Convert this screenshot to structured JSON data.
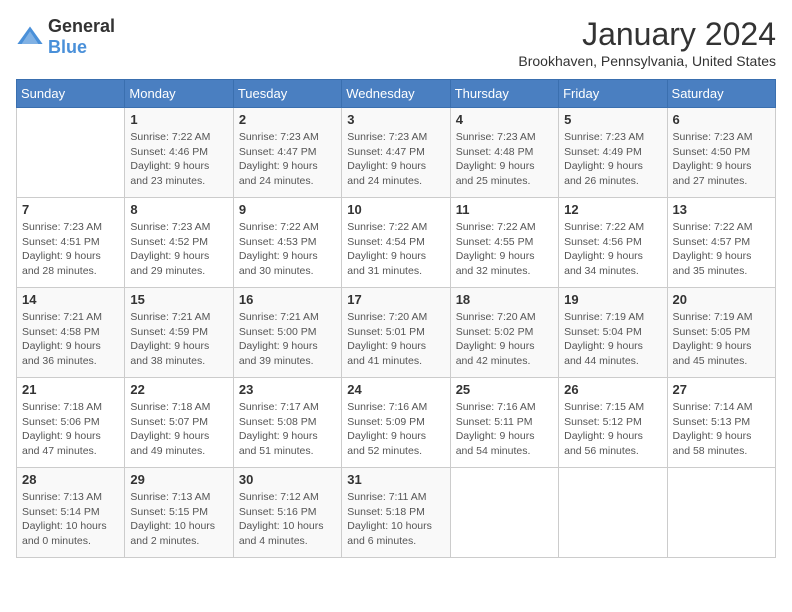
{
  "logo": {
    "general": "General",
    "blue": "Blue"
  },
  "title": "January 2024",
  "subtitle": "Brookhaven, Pennsylvania, United States",
  "header_days": [
    "Sunday",
    "Monday",
    "Tuesday",
    "Wednesday",
    "Thursday",
    "Friday",
    "Saturday"
  ],
  "weeks": [
    [
      {
        "day": "",
        "sunrise": "",
        "sunset": "",
        "daylight": ""
      },
      {
        "day": "1",
        "sunrise": "Sunrise: 7:22 AM",
        "sunset": "Sunset: 4:46 PM",
        "daylight": "Daylight: 9 hours and 23 minutes."
      },
      {
        "day": "2",
        "sunrise": "Sunrise: 7:23 AM",
        "sunset": "Sunset: 4:47 PM",
        "daylight": "Daylight: 9 hours and 24 minutes."
      },
      {
        "day": "3",
        "sunrise": "Sunrise: 7:23 AM",
        "sunset": "Sunset: 4:47 PM",
        "daylight": "Daylight: 9 hours and 24 minutes."
      },
      {
        "day": "4",
        "sunrise": "Sunrise: 7:23 AM",
        "sunset": "Sunset: 4:48 PM",
        "daylight": "Daylight: 9 hours and 25 minutes."
      },
      {
        "day": "5",
        "sunrise": "Sunrise: 7:23 AM",
        "sunset": "Sunset: 4:49 PM",
        "daylight": "Daylight: 9 hours and 26 minutes."
      },
      {
        "day": "6",
        "sunrise": "Sunrise: 7:23 AM",
        "sunset": "Sunset: 4:50 PM",
        "daylight": "Daylight: 9 hours and 27 minutes."
      }
    ],
    [
      {
        "day": "7",
        "sunrise": "Sunrise: 7:23 AM",
        "sunset": "Sunset: 4:51 PM",
        "daylight": "Daylight: 9 hours and 28 minutes."
      },
      {
        "day": "8",
        "sunrise": "Sunrise: 7:23 AM",
        "sunset": "Sunset: 4:52 PM",
        "daylight": "Daylight: 9 hours and 29 minutes."
      },
      {
        "day": "9",
        "sunrise": "Sunrise: 7:22 AM",
        "sunset": "Sunset: 4:53 PM",
        "daylight": "Daylight: 9 hours and 30 minutes."
      },
      {
        "day": "10",
        "sunrise": "Sunrise: 7:22 AM",
        "sunset": "Sunset: 4:54 PM",
        "daylight": "Daylight: 9 hours and 31 minutes."
      },
      {
        "day": "11",
        "sunrise": "Sunrise: 7:22 AM",
        "sunset": "Sunset: 4:55 PM",
        "daylight": "Daylight: 9 hours and 32 minutes."
      },
      {
        "day": "12",
        "sunrise": "Sunrise: 7:22 AM",
        "sunset": "Sunset: 4:56 PM",
        "daylight": "Daylight: 9 hours and 34 minutes."
      },
      {
        "day": "13",
        "sunrise": "Sunrise: 7:22 AM",
        "sunset": "Sunset: 4:57 PM",
        "daylight": "Daylight: 9 hours and 35 minutes."
      }
    ],
    [
      {
        "day": "14",
        "sunrise": "Sunrise: 7:21 AM",
        "sunset": "Sunset: 4:58 PM",
        "daylight": "Daylight: 9 hours and 36 minutes."
      },
      {
        "day": "15",
        "sunrise": "Sunrise: 7:21 AM",
        "sunset": "Sunset: 4:59 PM",
        "daylight": "Daylight: 9 hours and 38 minutes."
      },
      {
        "day": "16",
        "sunrise": "Sunrise: 7:21 AM",
        "sunset": "Sunset: 5:00 PM",
        "daylight": "Daylight: 9 hours and 39 minutes."
      },
      {
        "day": "17",
        "sunrise": "Sunrise: 7:20 AM",
        "sunset": "Sunset: 5:01 PM",
        "daylight": "Daylight: 9 hours and 41 minutes."
      },
      {
        "day": "18",
        "sunrise": "Sunrise: 7:20 AM",
        "sunset": "Sunset: 5:02 PM",
        "daylight": "Daylight: 9 hours and 42 minutes."
      },
      {
        "day": "19",
        "sunrise": "Sunrise: 7:19 AM",
        "sunset": "Sunset: 5:04 PM",
        "daylight": "Daylight: 9 hours and 44 minutes."
      },
      {
        "day": "20",
        "sunrise": "Sunrise: 7:19 AM",
        "sunset": "Sunset: 5:05 PM",
        "daylight": "Daylight: 9 hours and 45 minutes."
      }
    ],
    [
      {
        "day": "21",
        "sunrise": "Sunrise: 7:18 AM",
        "sunset": "Sunset: 5:06 PM",
        "daylight": "Daylight: 9 hours and 47 minutes."
      },
      {
        "day": "22",
        "sunrise": "Sunrise: 7:18 AM",
        "sunset": "Sunset: 5:07 PM",
        "daylight": "Daylight: 9 hours and 49 minutes."
      },
      {
        "day": "23",
        "sunrise": "Sunrise: 7:17 AM",
        "sunset": "Sunset: 5:08 PM",
        "daylight": "Daylight: 9 hours and 51 minutes."
      },
      {
        "day": "24",
        "sunrise": "Sunrise: 7:16 AM",
        "sunset": "Sunset: 5:09 PM",
        "daylight": "Daylight: 9 hours and 52 minutes."
      },
      {
        "day": "25",
        "sunrise": "Sunrise: 7:16 AM",
        "sunset": "Sunset: 5:11 PM",
        "daylight": "Daylight: 9 hours and 54 minutes."
      },
      {
        "day": "26",
        "sunrise": "Sunrise: 7:15 AM",
        "sunset": "Sunset: 5:12 PM",
        "daylight": "Daylight: 9 hours and 56 minutes."
      },
      {
        "day": "27",
        "sunrise": "Sunrise: 7:14 AM",
        "sunset": "Sunset: 5:13 PM",
        "daylight": "Daylight: 9 hours and 58 minutes."
      }
    ],
    [
      {
        "day": "28",
        "sunrise": "Sunrise: 7:13 AM",
        "sunset": "Sunset: 5:14 PM",
        "daylight": "Daylight: 10 hours and 0 minutes."
      },
      {
        "day": "29",
        "sunrise": "Sunrise: 7:13 AM",
        "sunset": "Sunset: 5:15 PM",
        "daylight": "Daylight: 10 hours and 2 minutes."
      },
      {
        "day": "30",
        "sunrise": "Sunrise: 7:12 AM",
        "sunset": "Sunset: 5:16 PM",
        "daylight": "Daylight: 10 hours and 4 minutes."
      },
      {
        "day": "31",
        "sunrise": "Sunrise: 7:11 AM",
        "sunset": "Sunset: 5:18 PM",
        "daylight": "Daylight: 10 hours and 6 minutes."
      },
      {
        "day": "",
        "sunrise": "",
        "sunset": "",
        "daylight": ""
      },
      {
        "day": "",
        "sunrise": "",
        "sunset": "",
        "daylight": ""
      },
      {
        "day": "",
        "sunrise": "",
        "sunset": "",
        "daylight": ""
      }
    ]
  ]
}
